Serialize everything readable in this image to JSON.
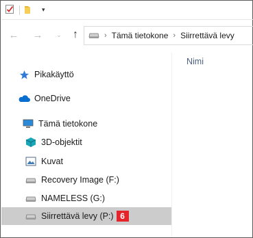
{
  "quick_access_toolbar": {
    "icons": [
      "properties-checkmark-icon",
      "new-folder-icon",
      "customize-dropdown-icon"
    ],
    "dropdown_glyph": "▾"
  },
  "navigation": {
    "back_glyph": "←",
    "forward_glyph": "→",
    "recent_glyph": "⌄",
    "up_glyph": "↑"
  },
  "address_bar": {
    "icon": "drive-icon",
    "crumbs": [
      "Tämä tietokone",
      "Siirrettävä levy"
    ]
  },
  "nav_pane": {
    "items": [
      {
        "label": "Pikakäyttö",
        "icon": "star-icon",
        "selected": false
      },
      {
        "label": "OneDrive",
        "icon": "cloud-icon",
        "selected": false
      },
      {
        "label": "Tämä tietokone",
        "icon": "computer-icon",
        "selected": false
      },
      {
        "label": "3D-objektit",
        "icon": "3d-objects-icon",
        "selected": false
      },
      {
        "label": "Kuvat",
        "icon": "pictures-icon",
        "selected": false
      },
      {
        "label": "Recovery Image (F:)",
        "icon": "drive-icon",
        "selected": false
      },
      {
        "label": "NAMELESS (G:)",
        "icon": "drive-icon",
        "selected": false
      },
      {
        "label": "Siirrettävä levy (P:)",
        "icon": "drive-icon",
        "selected": true,
        "badge": "6"
      }
    ]
  },
  "content": {
    "column_header": "Nimi"
  },
  "colors": {
    "selection": "#cccccc",
    "badge": "#e3242b",
    "header_text": "#4d6082",
    "onedrive": "#0a6ed1",
    "star": "#2f7bd6"
  }
}
